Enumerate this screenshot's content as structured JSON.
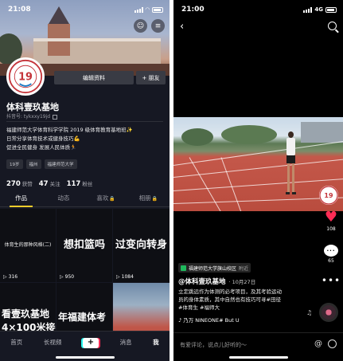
{
  "left": {
    "status": {
      "time": "21:08",
      "time_arrow": "↗"
    },
    "profile": {
      "edit_label": "编辑资料",
      "friend_label": "+ 朋友",
      "nickname": "体科壹玖基地",
      "uid_line": "抖音号: tykxxy19jd",
      "bio_lines": [
        "福建师范大学体育科学学院 2019 级体育教育基地班✨",
        "日常分享体育技术或健身技巧💪",
        "促进全民健身  发展人民体质🏃"
      ],
      "tags": [
        "19岁",
        "福州",
        "福建师范大学"
      ],
      "stats": [
        {
          "value": "270",
          "label": "获赞"
        },
        {
          "value": "47",
          "label": "关注"
        },
        {
          "value": "117",
          "label": "粉丝"
        }
      ]
    },
    "tabs": [
      "作品",
      "动态",
      "喜欢",
      "相册"
    ],
    "videos": [
      {
        "text": "",
        "small": "体育生的那种风格(二)",
        "plays": "316"
      },
      {
        "text": "想扣篮吗",
        "small": "",
        "plays": "950"
      },
      {
        "text": "过变向转身",
        "small": "",
        "plays": "1084"
      },
      {
        "text": "看壹玖基地",
        "text2": "4×100米接",
        "plays": ""
      },
      {
        "text": "年福建体考",
        "text2": "",
        "plays": ""
      },
      {
        "text": "",
        "text2": "",
        "plays": ""
      }
    ],
    "nav": [
      "首页",
      "长视频",
      "+",
      "消息",
      "我"
    ]
  },
  "right": {
    "status": {
      "time": "21:00",
      "time_arrow": "↗",
      "network": "4G"
    },
    "location": {
      "name": "福建师范大学旗山校区",
      "sub": "附近"
    },
    "author": "@体科壹玖基地",
    "date": "· 10月27日",
    "caption_lines": [
      "立定跳远作为体测的必考项目，及其考验运动",
      "员的身体素质，其中自然也有技巧可寻#田径",
      "#体育生 #福师大"
    ],
    "music": "♪ 乃万 NINEONE#    But U",
    "likes": "108",
    "comments": "65",
    "comment_placeholder": "有爱评论，说点儿好听的～",
    "at_symbol": "@"
  }
}
